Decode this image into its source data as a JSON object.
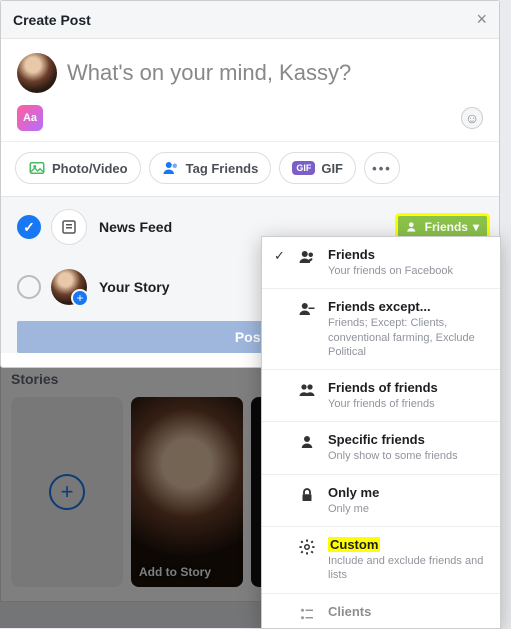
{
  "header": {
    "title": "Create Post"
  },
  "composer": {
    "placeholder": "What's on your mind, Kassy?",
    "bg_chip": "Aa"
  },
  "toolbar": {
    "photo": "Photo/Video",
    "tag": "Tag Friends",
    "gif_badge": "GIF",
    "gif": "GIF",
    "more": "•••"
  },
  "audience": {
    "news_feed": "News Feed",
    "your_story": "Your Story",
    "friends_btn": "Friends",
    "post": "Post"
  },
  "stories": {
    "heading": "Stories",
    "add": "Add to Story"
  },
  "dropdown": {
    "items": [
      {
        "title": "Friends",
        "sub": "Your friends on Facebook",
        "icon": "friends",
        "checked": true
      },
      {
        "title": "Friends except...",
        "sub": "Friends; Except: Clients, conventional farming, Exclude Political",
        "icon": "friends-except"
      },
      {
        "title": "Friends of friends",
        "sub": "Your friends of friends",
        "icon": "fof"
      },
      {
        "title": "Specific friends",
        "sub": "Only show to some friends",
        "icon": "specific"
      },
      {
        "title": "Only me",
        "sub": "Only me",
        "icon": "lock"
      },
      {
        "title": "Custom",
        "sub": "Include and exclude friends and lists",
        "icon": "gear",
        "highlight": true
      },
      {
        "title": "Clients",
        "sub": "",
        "icon": "list",
        "truncated": true
      }
    ]
  }
}
